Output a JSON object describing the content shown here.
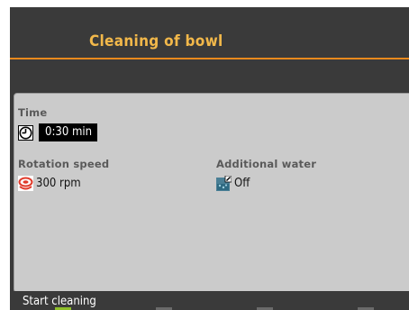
{
  "header": {
    "title": "Cleaning of bowl"
  },
  "panel": {
    "time": {
      "label": "Time",
      "value": "0:30 min",
      "icon": "clock-icon"
    },
    "rotation": {
      "label": "Rotation speed",
      "value": "300 rpm",
      "icon": "rotation-icon"
    },
    "water": {
      "label": "Additional water",
      "value": "Off",
      "icon": "water-icon"
    }
  },
  "footer": {
    "action": "Start cleaning"
  },
  "colors": {
    "title": "#f2b84a",
    "accent_line": "#e8891d",
    "background": "#3a3a3a",
    "panel": "#cbcbcb",
    "softkey_active": "#8fbf2a"
  }
}
